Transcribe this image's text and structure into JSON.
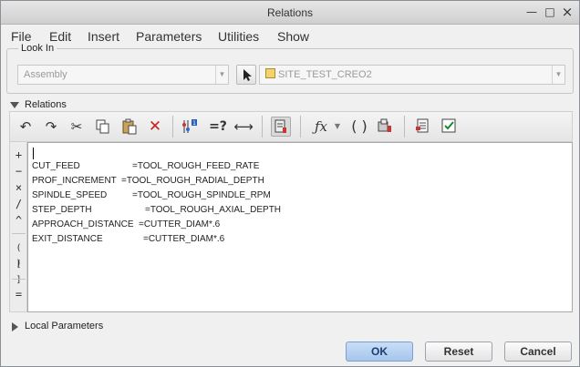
{
  "window": {
    "title": "Relations"
  },
  "titlebar": {
    "close_glyph": "×",
    "maximize_glyph": "□",
    "minimize_glyph": "—"
  },
  "menu": [
    "File",
    "Edit",
    "Insert",
    "Parameters",
    "Utilities",
    "Show"
  ],
  "look_in": {
    "legend": "Look In",
    "type_value": "Assembly",
    "model_value": "SITE_TEST_CREO2"
  },
  "relations_section": {
    "label": "Relations"
  },
  "toolbar": {
    "icons": [
      "undo-icon",
      "redo-icon",
      "cut-icon",
      "copy-icon",
      "paste-icon",
      "delete-icon",
      "insert-parameter-icon",
      "evaluate-icon",
      "measure-icon",
      "sort-relations-icon",
      "function-icon",
      "parentheses-icon",
      "local-parameters-icon",
      "show-units-icon",
      "verify-icon"
    ]
  },
  "sidebar": {
    "buttons": [
      "+",
      "−",
      "×",
      "/",
      "^",
      "( )",
      "[ ]",
      "="
    ]
  },
  "relations": [
    {
      "lhs": "CUT_FEED",
      "rhs": "=TOOL_ROUGH_FEED_RATE"
    },
    {
      "lhs": "PROF_INCREMENT",
      "rhs": "=TOOL_ROUGH_RADIAL_DEPTH"
    },
    {
      "lhs": "SPINDLE_SPEED",
      "rhs": "=TOOL_ROUGH_SPINDLE_RPM"
    },
    {
      "lhs": "STEP_DEPTH",
      "rhs": "=TOOL_ROUGH_AXIAL_DEPTH"
    },
    {
      "lhs": "APPROACH_DISTANCE",
      "rhs": "=CUTTER_DIAM*.6"
    },
    {
      "lhs": "EXIT_DISTANCE",
      "rhs": "=CUTTER_DIAM*.6"
    }
  ],
  "local_parameters_section": {
    "label": "Local Parameters"
  },
  "buttons": {
    "ok": "OK",
    "reset": "Reset",
    "cancel": "Cancel"
  },
  "colors": {
    "primary_button": "#b6d1f1",
    "editor_bg": "#ffffff",
    "dialog_bg": "#f0f0f0"
  }
}
